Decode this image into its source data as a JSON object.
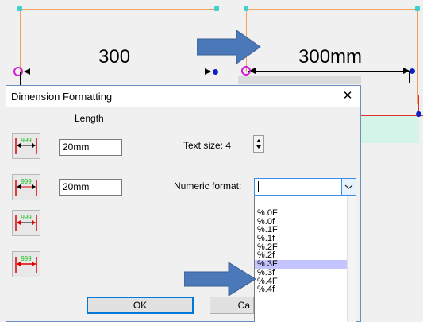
{
  "canvas": {
    "left_dimension": "300",
    "right_dimension": "300mm"
  },
  "dialog": {
    "title": "Dimension Formatting",
    "close_glyph": "✕",
    "length_header": "Length",
    "length_field_1": "20mm",
    "length_field_2": "20mm",
    "text_size_label": "Text size: 4",
    "numeric_format_label": "Numeric format:",
    "numeric_format_value": "",
    "ok_label": "OK",
    "cancel_label": "Ca",
    "dim_icon_text": "999"
  },
  "dropdown": {
    "options": [
      "%.0F",
      "%.0f",
      "%.1F",
      "%.1f",
      "%.2F",
      "%.2f",
      "%.3F",
      "%.3f",
      "%.4F",
      "%.4f"
    ],
    "selected": "%.3F"
  },
  "colors": {
    "accent_blue": "#4a78b8",
    "selection": "#c4c4ff",
    "dimension_icon_red": "#e00000",
    "dimension_icon_green": "#20c020"
  }
}
